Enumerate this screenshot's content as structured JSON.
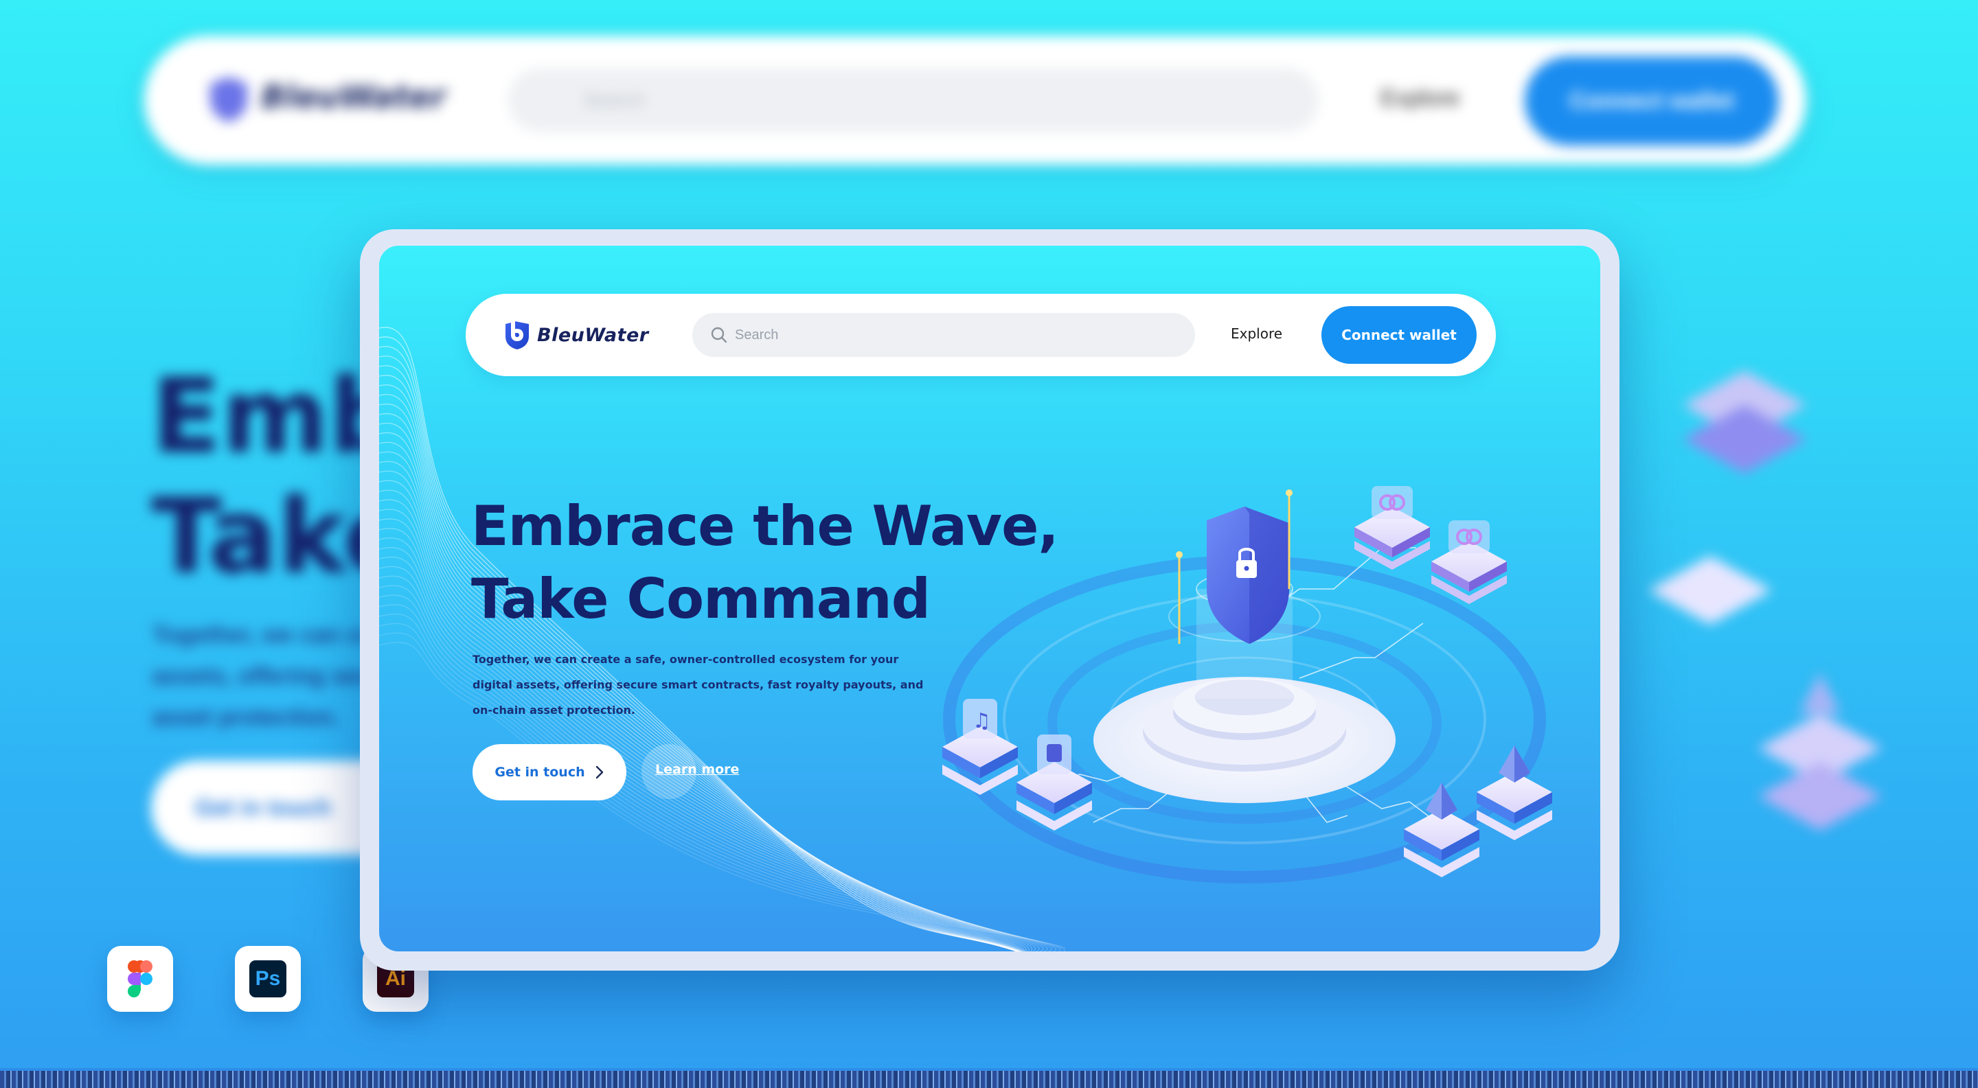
{
  "brand": {
    "name": "BleuWater",
    "logo_icon": "shield-b-logo-icon"
  },
  "nav": {
    "search_placeholder": "Search",
    "explore_label": "Explore",
    "connect_label": "Connect wallet"
  },
  "hero": {
    "headline_line1": "Embrace the Wave,",
    "headline_line2": "Take Command",
    "paragraph": "Together, we can create a safe, owner-controlled ecosystem for your digital assets, offering secure smart contracts, fast royalty payouts, and on-chain asset protection.",
    "primary_cta": "Get in touch",
    "secondary_cta": "Learn more"
  },
  "background": {
    "headline_line1": "Embr",
    "headline_line2": "Take",
    "search_placeholder": "Search",
    "explore_label": "Explore",
    "connect_label": "Connect wallet",
    "paragraph_lines": [
      "Together, we can create",
      "assets, offering secure",
      "asset protection."
    ],
    "primary_cta": "Get in touch"
  },
  "tools": [
    {
      "name": "Figma",
      "icon": "figma-icon",
      "label": ""
    },
    {
      "name": "Photoshop",
      "icon": "photoshop-icon",
      "label": "Ps"
    },
    {
      "name": "Illustrator",
      "icon": "illustrator-icon",
      "label": "Ai"
    }
  ],
  "colors": {
    "background_top": "#35eef8",
    "background_bottom": "#2f9ef2",
    "accent_blue": "#1491f3",
    "headline_navy": "#14226b",
    "link_blue": "#1a6fd8"
  }
}
